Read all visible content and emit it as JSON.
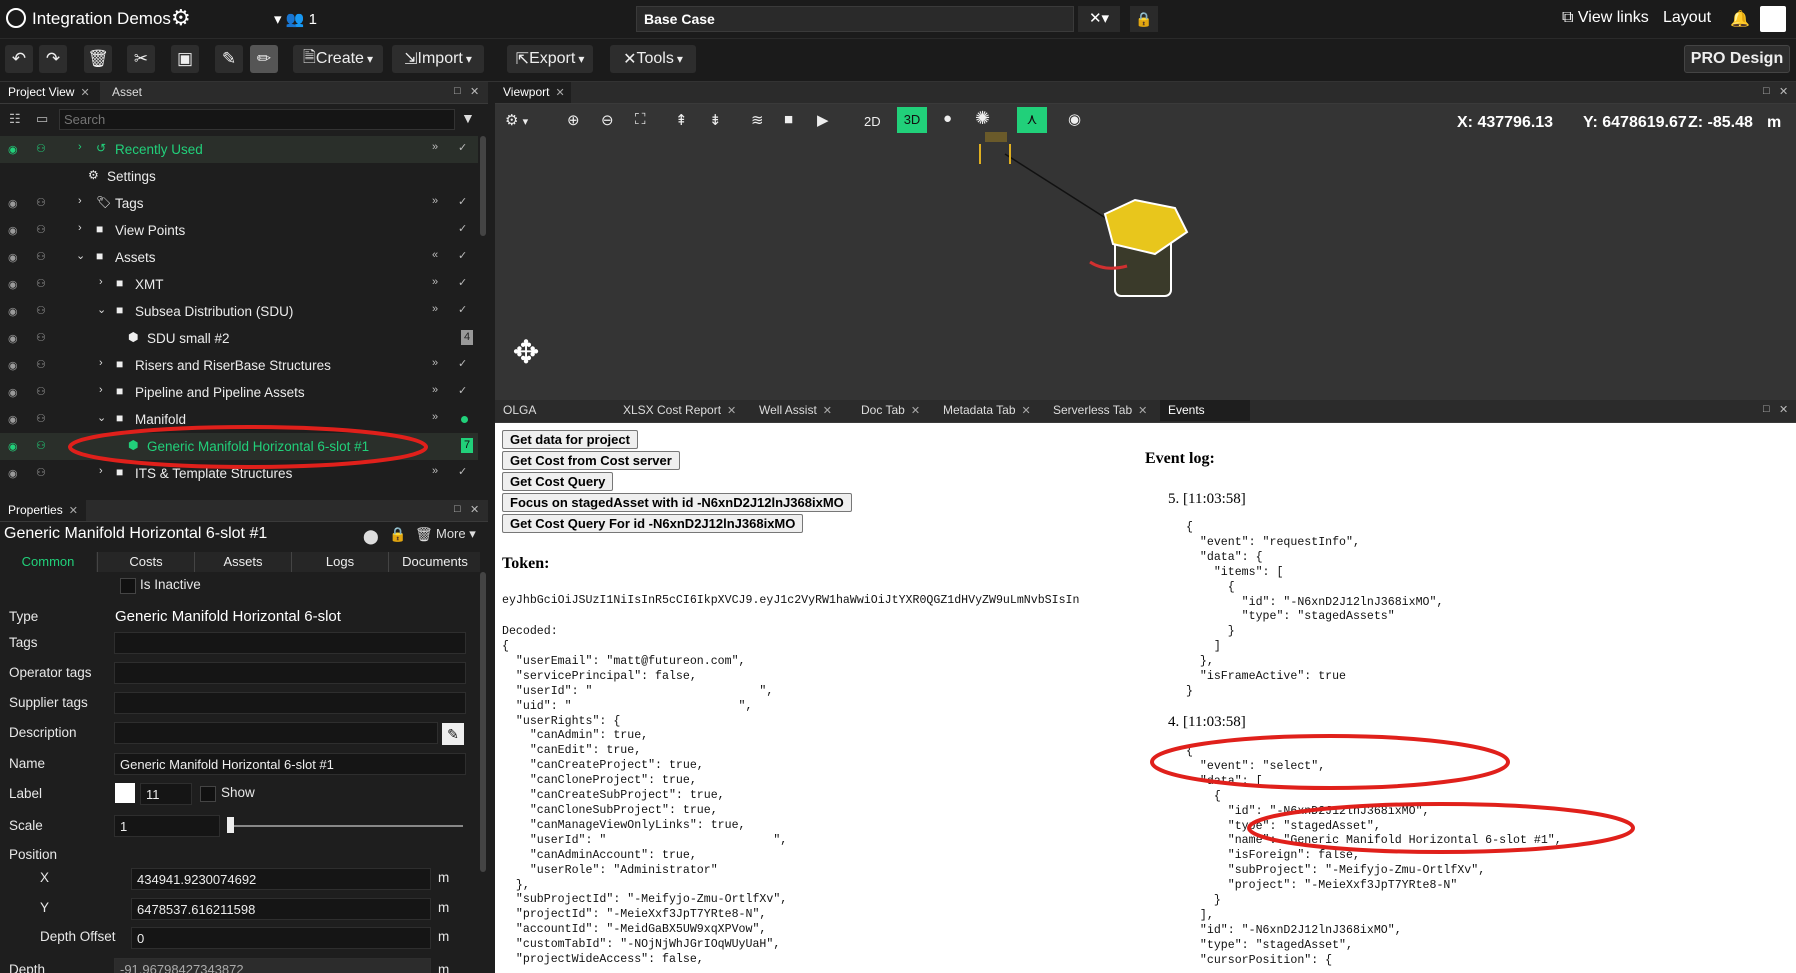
{
  "header": {
    "app_title": "Integration Demos",
    "users_count": "1",
    "case_name": "Base Case",
    "view_links": "View links",
    "layout": "Layout"
  },
  "toolbar": {
    "create": "Create",
    "import": "Import",
    "export": "Export",
    "tools": "Tools",
    "pro_design": "PRO Design"
  },
  "project_panel": {
    "tabs": [
      "Project View",
      "Asset Library"
    ],
    "search_placeholder": "Search",
    "tree": [
      {
        "label": "Recently Used",
        "badge": ""
      },
      {
        "label": "Settings",
        "badge": ""
      },
      {
        "label": "Tags",
        "badge": ""
      },
      {
        "label": "View Points",
        "badge": ""
      },
      {
        "label": "Assets",
        "badge": ""
      },
      {
        "label": "XMT",
        "badge": ""
      },
      {
        "label": "Subsea Distribution (SDU)",
        "badge": ""
      },
      {
        "label": "SDU small #2",
        "badge": "4"
      },
      {
        "label": "Risers and RiserBase Structures",
        "badge": ""
      },
      {
        "label": "Pipeline and Pipeline Assets",
        "badge": ""
      },
      {
        "label": "Manifold",
        "badge": ""
      },
      {
        "label": "Generic Manifold Horizontal 6-slot #1",
        "badge": "7"
      },
      {
        "label": "ITS & Template Structures",
        "badge": ""
      }
    ]
  },
  "properties": {
    "tab": "Properties",
    "title": "Generic Manifold Horizontal 6-slot #1",
    "more": "More",
    "subtabs": [
      "Common",
      "Costs",
      "Assets",
      "Logs",
      "Documents"
    ],
    "is_inactive": "Is Inactive",
    "labels": {
      "type": "Type",
      "tags": "Tags",
      "operator_tags": "Operator tags",
      "supplier_tags": "Supplier tags",
      "description": "Description",
      "name": "Name",
      "label": "Label",
      "show": "Show",
      "scale": "Scale",
      "position": "Position",
      "x": "X",
      "y": "Y",
      "depth_offset": "Depth Offset",
      "depth": "Depth"
    },
    "values": {
      "type": "Generic Manifold Horizontal 6-slot",
      "name": "Generic Manifold Horizontal 6-slot #1",
      "label": "11",
      "scale": "1",
      "x": "434941.9230074692",
      "y": "6478537.616211598",
      "depth_offset": "0",
      "depth": "-91.96798427343872",
      "unit": "m"
    }
  },
  "viewport": {
    "tab": "Viewport",
    "btn_2d": "2D",
    "btn_3d": "3D",
    "coords": {
      "x": "X: 437796.13",
      "y": "Y: 6478619.67",
      "z": "Z: -85.48",
      "unit": "m"
    }
  },
  "bottom_tabs": [
    "OLGA Integration",
    "XLSX Cost Report",
    "Well Assist",
    "Doc Tab",
    "Metadata Tab",
    "Serverless Tab",
    "Events Tab"
  ],
  "events": {
    "buttons": [
      "Get data for project",
      "Get Cost from Cost server",
      "Get Cost Query",
      "Focus on stagedAsset with id -N6xnD2J12lnJ368ixMO",
      "Get Cost Query For id -N6xnD2J12lnJ368ixMO"
    ],
    "token_title": "Token:",
    "token": "eyJhbGciOiJSUzI1NiIsInR5cCI6IkpXVCJ9.eyJ1c2VyRW1haWwiOiJtYXR0QGZ1dHVyZW9uLmNvbSIsIn",
    "decoded_label": "Decoded:",
    "decoded": "{\n  \"userEmail\": \"matt@futureon.com\",\n  \"servicePrincipal\": false,\n  \"userId\": \"                        \",\n  \"uid\": \"                        \",\n  \"userRights\": {\n    \"canAdmin\": true,\n    \"canEdit\": true,\n    \"canCreateProject\": true,\n    \"canCloneProject\": true,\n    \"canCreateSubProject\": true,\n    \"canCloneSubProject\": true,\n    \"canManageViewOnlyLinks\": true,\n    \"userId\": \"                        \",\n    \"canAdminAccount\": true,\n    \"userRole\": \"Administrator\"\n  },\n  \"subProjectId\": \"-Meifyjo-Zmu-OrtlfXv\",\n  \"projectId\": \"-MeieXxf3JpT7YRte8-N\",\n  \"accountId\": \"-MeidGaBX5UW9xqXPVow\",\n  \"customTabId\": \"-NOjNjWhJGrIOqWUyUaH\",\n  \"projectWideAccess\": false,",
    "event_log_title": "Event log:",
    "event5_header": "5. [11:03:58]",
    "event5_body": "{\n  \"event\": \"requestInfo\",\n  \"data\": {\n    \"items\": [\n      {\n        \"id\": \"-N6xnD2J12lnJ368ixMO\",\n        \"type\": \"stagedAssets\"\n      }\n    ]\n  },\n  \"isFrameActive\": true\n}",
    "event4_header": "4. [11:03:58]",
    "event4_body": "{\n  \"event\": \"select\",\n  \"data\": [\n    {\n      \"id\": \"-N6xnD2J12lnJ368ixMO\",\n      \"type\": \"stagedAsset\",\n      \"name\": \"Generic Manifold Horizontal 6-slot #1\",\n      \"isForeign\": false,\n      \"subProject\": \"-Meifyjo-Zmu-OrtlfXv\",\n      \"project\": \"-MeieXxf3JpT7YRte8-N\"\n    }\n  ],\n  \"id\": \"-N6xnD2J12lnJ368ixMO\",\n  \"type\": \"stagedAsset\",\n  \"cursorPosition\": {"
  },
  "colors": {
    "accent": "#21d07a",
    "annotation": "#e0201b"
  }
}
